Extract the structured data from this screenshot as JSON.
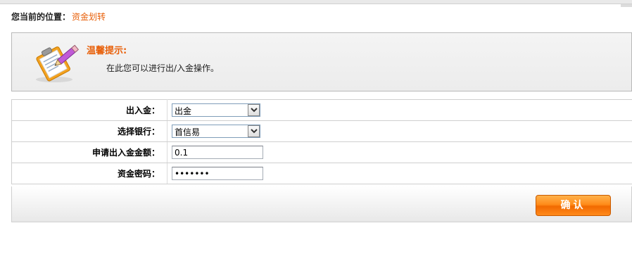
{
  "breadcrumb": {
    "prefix": "您当前的位置：",
    "current": "资金划转"
  },
  "tip": {
    "title": "温馨提示:",
    "text": "在此您可以进行出/入金操作。",
    "icon": "notepad-pencil-icon"
  },
  "form": {
    "direction": {
      "label": "出入金：",
      "value": "出金"
    },
    "bank": {
      "label": "选择银行：",
      "value": "首信易"
    },
    "amount": {
      "label": "申请出入金金额：",
      "value": "0.1"
    },
    "password": {
      "label": "资金密码：",
      "value": "1234567"
    }
  },
  "actions": {
    "confirm_label": "确认"
  },
  "colors": {
    "accent": "#e8600a",
    "button": "#ff8c1a"
  }
}
